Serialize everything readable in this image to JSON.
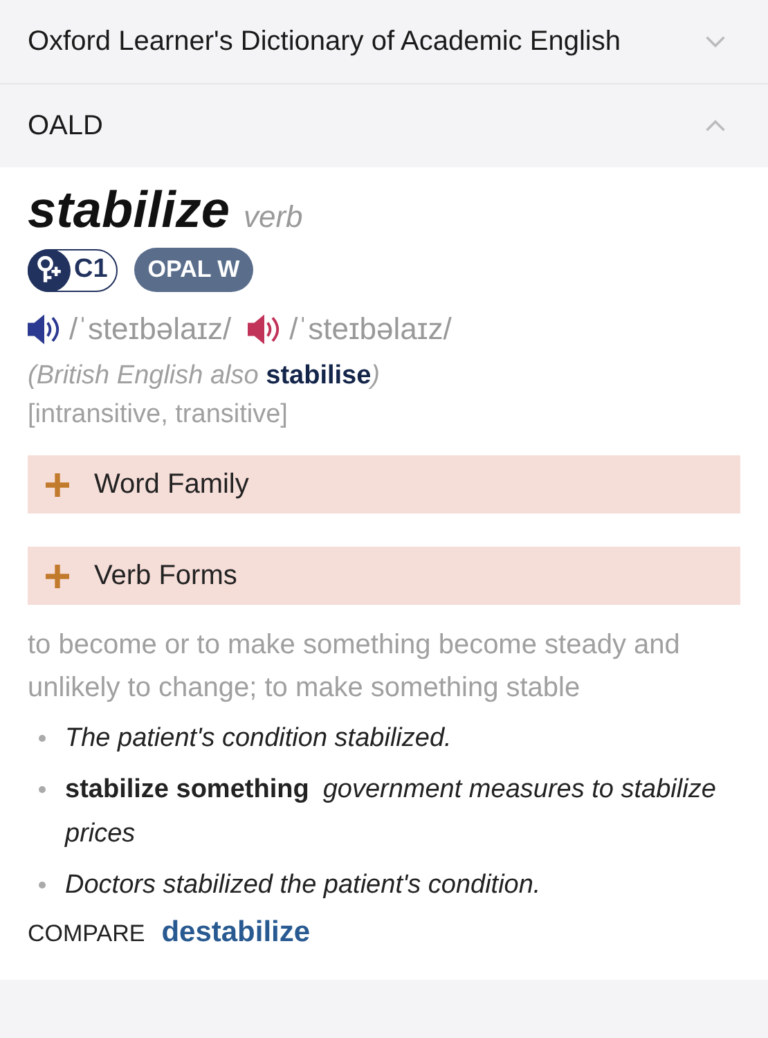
{
  "dictionaries": [
    {
      "title": "Oxford Learner's Dictionary of Academic English",
      "expanded": false
    },
    {
      "title": "OALD",
      "expanded": true
    }
  ],
  "entry": {
    "headword": "stabilize",
    "part_of_speech": "verb",
    "badges": [
      {
        "kind": "level",
        "label": "C1"
      },
      {
        "kind": "list",
        "label": "OPAL W"
      }
    ],
    "pronunciations": [
      {
        "text": "/ˈsteɪbəlaɪz/",
        "color": "#2b3990"
      },
      {
        "text": "/ˈsteɪbəlaɪz/",
        "color": "#c2335a"
      }
    ],
    "variant": "(British English also **stabilise**)",
    "grammar": "[intransitive, transitive]",
    "sections": [
      {
        "label": "Word Family",
        "expanded": false
      },
      {
        "label": "Verb Forms",
        "expanded": false
      }
    ],
    "definition": "to become or to make something become steady and unlikely to change; to make something stable",
    "examples": [
      {
        "text": "The patient's condition stabilized."
      },
      {
        "pattern": "stabilize something",
        "text": "government measures to stabilize prices"
      },
      {
        "text": "Doctors stabilized the patient's condition."
      }
    ],
    "compare": {
      "label": "COMPARE",
      "word": "destabilize"
    }
  }
}
